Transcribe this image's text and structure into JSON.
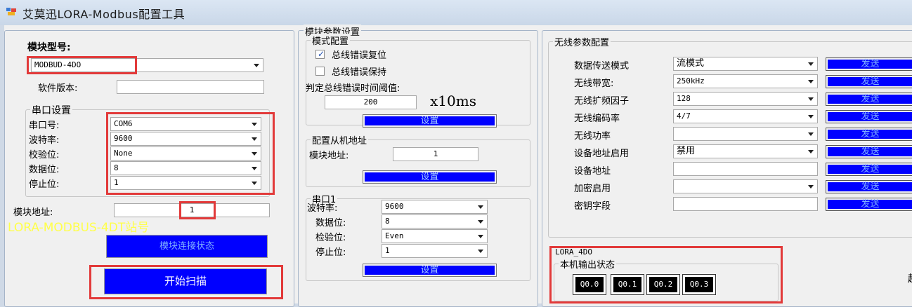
{
  "window": {
    "title": "艾莫迅LORA-Modbus配置工具"
  },
  "left": {
    "model_label": "模块型号:",
    "model_value": "MODBUD-4DO",
    "version_label": "软件版本:",
    "version_value": "",
    "serial_group": "串口设置",
    "serial_fields": [
      {
        "label": "串口号:",
        "value": "COM6"
      },
      {
        "label": "波特率:",
        "value": "9600"
      },
      {
        "label": "校验位:",
        "value": "None"
      },
      {
        "label": "数据位:",
        "value": "8"
      },
      {
        "label": "停止位:",
        "value": "1"
      }
    ],
    "address_label": "模块地址:",
    "address_value": "1",
    "station_text": "LORA-MODBUS-4DT站号",
    "status_button": "模块连接状态",
    "scan_button": "开始扫描"
  },
  "middle": {
    "group_title": "模块参数设置",
    "mode_group": "模式配置",
    "check_reset": "总线错误复位",
    "check_reset_checked": true,
    "check_hold": "总线错误保持",
    "check_hold_checked": false,
    "threshold_label": "判定总线错误时间阈值:",
    "threshold_value": "200",
    "threshold_unit": "x10ms",
    "set_label": "设置",
    "slave_group": "配置从机地址",
    "slave_address_label": "模块地址:",
    "slave_address_value": "1",
    "serial1_group": "串口1",
    "serial1_fields": [
      {
        "label": "波特率:",
        "value": "9600"
      },
      {
        "label": "数据位:",
        "value": "8"
      },
      {
        "label": "检验位:",
        "value": "Even"
      },
      {
        "label": "停止位:",
        "value": "1"
      }
    ]
  },
  "right": {
    "group_title": "无线参数配置",
    "rows": [
      {
        "label": "数据传送模式",
        "value": "流模式",
        "button": "发送"
      },
      {
        "label": "无线带宽:",
        "value": "250kHz",
        "button": "发送"
      },
      {
        "label": "无线扩频因子",
        "value": "128",
        "button": "发送"
      },
      {
        "label": "无线编码率",
        "value": "4/7",
        "button": "发送"
      },
      {
        "label": "无线功率",
        "value": "",
        "button": "发送"
      },
      {
        "label": "设备地址启用",
        "value": "禁用",
        "button": "发送"
      },
      {
        "label": "设备地址",
        "value": "",
        "button": "发送"
      },
      {
        "label": "加密启用",
        "value": "",
        "button": "发送"
      },
      {
        "label": "密钥字段",
        "value": "",
        "button": "发送"
      }
    ],
    "lora_label": "LORA_4DO",
    "output_group": "本机输出状态",
    "outputs": [
      "Q0.0",
      "Q0.1",
      "Q0.2",
      "Q0.3"
    ]
  },
  "colors": {
    "highlight": "#e23a3a",
    "button_blue": "#0000ff",
    "station_yellow": "#ffff4a"
  }
}
